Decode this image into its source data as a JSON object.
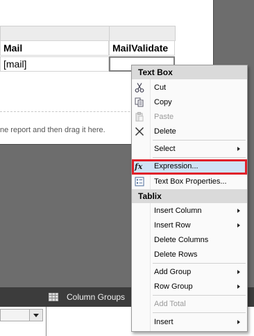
{
  "report": {
    "columns": [
      "Mail",
      "MailValidate"
    ],
    "row_values": [
      "[mail]",
      ""
    ],
    "drop_hint": "ne report and then drag it here."
  },
  "grouping": {
    "column_groups_label": "Column Groups"
  },
  "context_menu": {
    "textbox_header": "Text Box",
    "tablix_header": "Tablix",
    "items": {
      "cut": "Cut",
      "copy": "Copy",
      "paste": "Paste",
      "delete": "Delete",
      "select": "Select",
      "expression": "Expression...",
      "textbox_properties": "Text Box Properties...",
      "insert_column": "Insert Column",
      "insert_row": "Insert Row",
      "delete_columns": "Delete Columns",
      "delete_rows": "Delete Rows",
      "add_group": "Add Group",
      "row_group": "Row Group",
      "add_total": "Add Total",
      "insert": "Insert"
    },
    "icons": {
      "cut": "scissors-icon",
      "copy": "copy-icon",
      "paste": "paste-icon",
      "delete": "delete-x-icon",
      "expression": "fx-icon",
      "textbox_properties": "properties-icon"
    },
    "highlight_border_color": "#e0202a"
  }
}
